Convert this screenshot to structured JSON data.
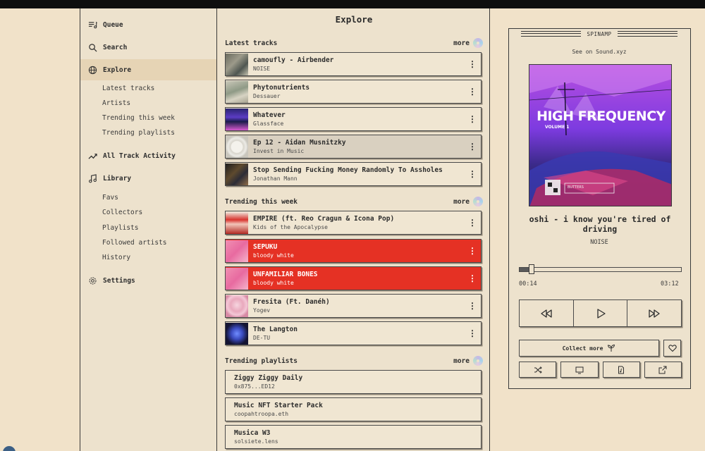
{
  "sidebar": {
    "nav": [
      {
        "label": "Queue",
        "icon": "queue-icon"
      },
      {
        "label": "Search",
        "icon": "search-icon"
      },
      {
        "label": "Explore",
        "icon": "globe-icon",
        "active": true
      },
      {
        "label": "All Track Activity",
        "icon": "activity-icon"
      },
      {
        "label": "Library",
        "icon": "music-note-icon"
      },
      {
        "label": "Settings",
        "icon": "gear-icon"
      }
    ],
    "explore_sub": [
      "Latest tracks",
      "Artists",
      "Trending this week",
      "Trending playlists"
    ],
    "library_sub": [
      "Favs",
      "Collectors",
      "Playlists",
      "Followed artists",
      "History"
    ]
  },
  "main": {
    "title": "Explore",
    "latest": {
      "title": "Latest tracks",
      "more": "more",
      "tracks": [
        {
          "title": "camoufly - Airbender",
          "artist": "NOISE"
        },
        {
          "title": "Phytonutrients",
          "artist": "Dessauer"
        },
        {
          "title": "Whatever",
          "artist": "Glassface"
        },
        {
          "title": "Ep 12 - Aidan Musnitzky",
          "artist": "Invest in Music"
        },
        {
          "title": "Stop Sending Fucking Money Randomly To Assholes",
          "artist": "Jonathan Mann"
        }
      ]
    },
    "trending": {
      "title": "Trending this week",
      "more": "more",
      "tracks": [
        {
          "title": "EMPIRE (ft. Reo Cragun & Icona Pop)",
          "artist": "Kids of the Apocalypse"
        },
        {
          "title": "SEPUKU",
          "artist": "bloody white"
        },
        {
          "title": "UNFAMILIAR BONES",
          "artist": "bloody white"
        },
        {
          "title": "Fresita (Ft. Danéh)",
          "artist": "Yogev"
        },
        {
          "title": "The Langton",
          "artist": "DE-TU"
        }
      ]
    },
    "playlists": {
      "title": "Trending playlists",
      "more": "more",
      "items": [
        {
          "title": "Ziggy Ziggy Daily",
          "owner": "0x875...ED12"
        },
        {
          "title": "Music NFT Starter Pack",
          "owner": "coopahtroopa.eth"
        },
        {
          "title": "Musica W3",
          "owner": "solsiete.lens"
        }
      ]
    },
    "kebab": "⋮"
  },
  "player": {
    "title": "SPINAMP",
    "see_on": "See on Sound.xyz",
    "cover": {
      "headline": "HIGH FREQUENCY",
      "volume": "VOLUME 1",
      "badge": "BUTTERS"
    },
    "track_title": "oshi - i know you're tired of driving",
    "track_artist": "NOISE",
    "progress": 0.073,
    "time_current": "00:14",
    "time_total": "03:12",
    "collect_label": "Collect more"
  },
  "colors": {
    "background": "#f1e2c9",
    "panel": "#ede2cd",
    "border": "#3a3a3a",
    "highlight_red": "#e53124"
  }
}
